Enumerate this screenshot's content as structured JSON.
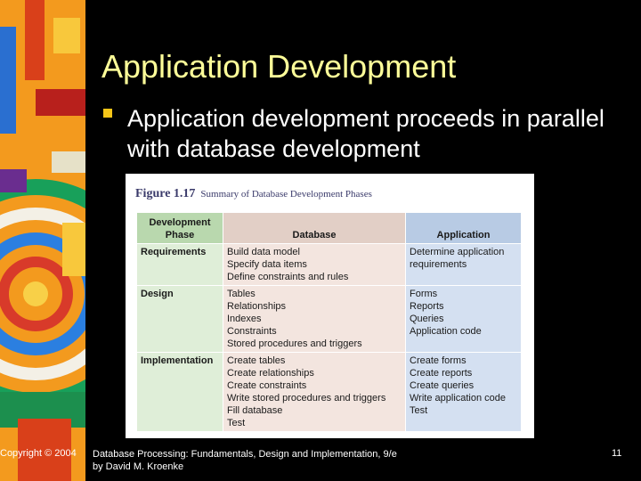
{
  "slide": {
    "title": "Application Development",
    "bullet": "Application development proceeds in parallel with database development"
  },
  "figure": {
    "number": "Figure 1.17",
    "caption": "Summary of Database Development Phases",
    "headers": {
      "phase": "Development Phase",
      "database": "Database",
      "application": "Application"
    },
    "rows": [
      {
        "phase": "Requirements",
        "database": [
          "Build data model",
          "Specify data items",
          "Define constraints and rules"
        ],
        "application": [
          "Determine application",
          "requirements"
        ]
      },
      {
        "phase": "Design",
        "database": [
          "Tables",
          "Relationships",
          "Indexes",
          "Constraints",
          "Stored procedures and triggers"
        ],
        "application": [
          "Forms",
          "Reports",
          "Queries",
          "Application code"
        ]
      },
      {
        "phase": "Implementation",
        "database": [
          "Create tables",
          "Create relationships",
          "Create constraints",
          "Write stored procedures and triggers",
          "Fill database",
          "Test"
        ],
        "application": [
          "Create forms",
          "Create reports",
          "Create queries",
          "Write application code",
          "Test"
        ]
      }
    ]
  },
  "footer": {
    "copyright": "Copyright © 2004",
    "book_line1": "Database Processing: Fundamentals, Design and Implementation, 9/e",
    "book_line2": "by David M. Kroenke",
    "page_number": "11"
  },
  "colors": {
    "title": "#ffff99",
    "background": "#000000",
    "bullet_marker": "#f5c518"
  }
}
